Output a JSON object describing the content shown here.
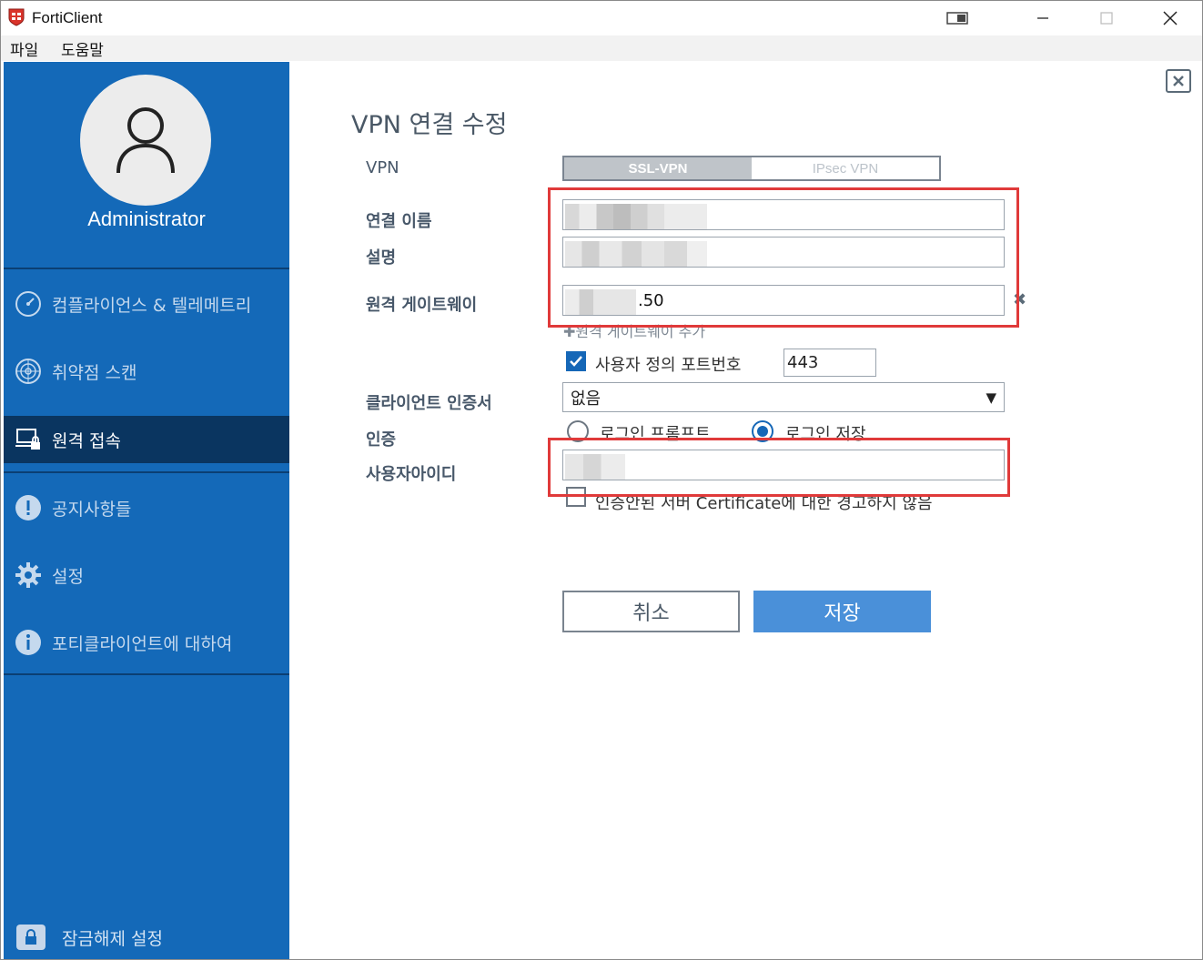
{
  "window": {
    "title": "FortiClient"
  },
  "menu": [
    "파일",
    "도움말"
  ],
  "sidebar": {
    "user_name": "Administrator",
    "items": [
      {
        "label": "컴플라이언스 & 텔레메트리",
        "icon": "dashboard-icon"
      },
      {
        "label": "취약점 스캔",
        "icon": "radar-icon"
      },
      {
        "label": "원격 접속",
        "icon": "remote-access-icon",
        "active": true
      },
      {
        "label": "공지사항들",
        "icon": "notice-icon"
      },
      {
        "label": "설정",
        "icon": "gear-icon"
      },
      {
        "label": "포티클라이언트에 대하여",
        "icon": "info-icon"
      }
    ],
    "unlock_label": "잠금해제 설정"
  },
  "form": {
    "title": "VPN 연결 수정",
    "vpn_label": "VPN",
    "tabs": [
      "SSL-VPN",
      "IPsec VPN"
    ],
    "connection_name_label": "연결 이름",
    "description_label": "설명",
    "remote_gateway_label": "원격 게이트웨이",
    "remote_gateway_value": ".50",
    "add_gateway_label": "원격 게이트웨이 추가",
    "custom_port_label": "사용자 정의 포트번호",
    "custom_port_checked": true,
    "port_value": "443",
    "client_cert_label": "클라이언트 인증서",
    "client_cert_value": "없음",
    "auth_label": "인증",
    "auth_options": [
      "로그인 프롬프트",
      "로그인 저장"
    ],
    "auth_selected": "로그인 저장",
    "username_label": "사용자아이디",
    "no_warn_label": "인증안된 서버 Certificate에 대한 경고하지 않음",
    "no_warn_checked": false,
    "cancel_label": "취소",
    "save_label": "저장"
  },
  "colors": {
    "sidebar": "#1469b8",
    "active_item": "#0a3560",
    "save_button": "#4a90d9",
    "highlight": "#e03a3a"
  }
}
